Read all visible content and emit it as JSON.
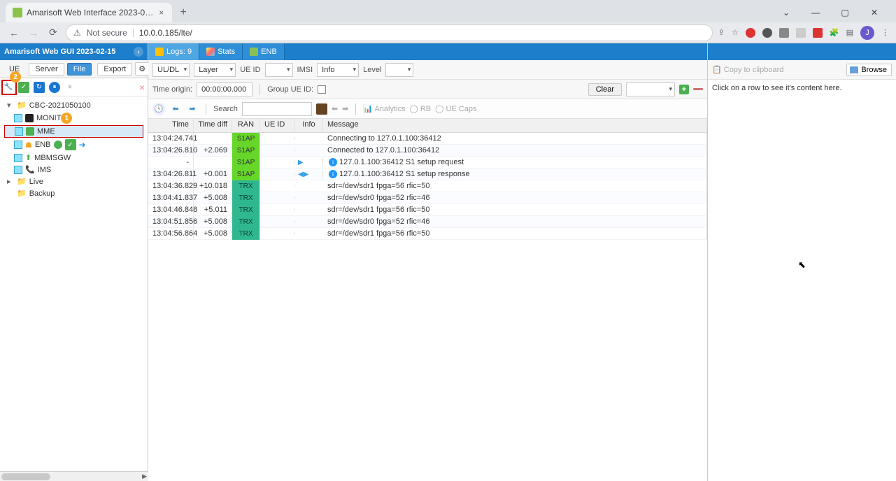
{
  "browser": {
    "tab_title": "Amarisoft Web Interface 2023-0…",
    "url": "10.0.0.185/lte/",
    "not_secure": "Not secure",
    "avatar_letter": "J"
  },
  "app_header": {
    "title": "Amarisoft Web GUI 2023-02-15"
  },
  "left_tabs": {
    "ue": "UE",
    "server": "Server",
    "file": "File",
    "export": "Export"
  },
  "tree": {
    "root": "CBC-2021050100",
    "nodes": [
      {
        "label": "MONIT"
      },
      {
        "label": "MME"
      },
      {
        "label": "ENB"
      },
      {
        "label": "MBMSGW"
      },
      {
        "label": "IMS"
      }
    ],
    "live": "Live",
    "backup": "Backup"
  },
  "main_tabs": {
    "logs": "Logs: 9",
    "stats": "Stats",
    "enb": "ENB"
  },
  "filters": {
    "uldl": "UL/DL",
    "layer": "Layer",
    "ueid": "UE ID",
    "imsi": "IMSI",
    "info": "Info",
    "level": "Level",
    "time_origin_label": "Time origin:",
    "time_origin_value": "00:00:00.000",
    "group_ueid": "Group UE ID:",
    "clear": "Clear",
    "search_label": "Search",
    "analytics": "Analytics",
    "rb": "RB",
    "ue_caps": "UE Caps"
  },
  "columns": {
    "time": "Time",
    "time_diff": "Time diff",
    "ran": "RAN",
    "ue_id": "UE ID",
    "info": "Info",
    "message": "Message"
  },
  "rows": [
    {
      "time": "13:04:24.741",
      "diff": "",
      "ran": "S1AP",
      "info": "",
      "msg": "Connecting to 127.0.1.100:36412"
    },
    {
      "time": "13:04:26.810",
      "diff": "+2.069",
      "ran": "S1AP",
      "info": "",
      "msg": "Connected to 127.0.1.100:36412"
    },
    {
      "time": "-",
      "diff": "",
      "ran": "S1AP",
      "info": "i_out",
      "msg": "127.0.1.100:36412 S1 setup request"
    },
    {
      "time": "13:04:26.811",
      "diff": "+0.001",
      "ran": "S1AP",
      "info": "i_in",
      "msg": "127.0.1.100:36412 S1 setup response"
    },
    {
      "time": "13:04:36.829",
      "diff": "+10.018",
      "ran": "TRX",
      "info": "",
      "msg": "sdr=/dev/sdr1 fpga=56 rfic=50"
    },
    {
      "time": "13:04:41.837",
      "diff": "+5.008",
      "ran": "TRX",
      "info": "",
      "msg": "sdr=/dev/sdr0 fpga=52 rfic=46"
    },
    {
      "time": "13:04:46.848",
      "diff": "+5.011",
      "ran": "TRX",
      "info": "",
      "msg": "sdr=/dev/sdr1 fpga=56 rfic=50"
    },
    {
      "time": "13:04:51.856",
      "diff": "+5.008",
      "ran": "TRX",
      "info": "",
      "msg": "sdr=/dev/sdr0 fpga=52 rfic=46"
    },
    {
      "time": "13:04:56.864",
      "diff": "+5.008",
      "ran": "TRX",
      "info": "",
      "msg": "sdr=/dev/sdr1 fpga=56 rfic=50"
    }
  ],
  "right": {
    "copy": "Copy to clipboard",
    "browse": "Browse",
    "hint": "Click on a row to see it's content here."
  },
  "annotations": {
    "one": "1",
    "two": "2"
  }
}
